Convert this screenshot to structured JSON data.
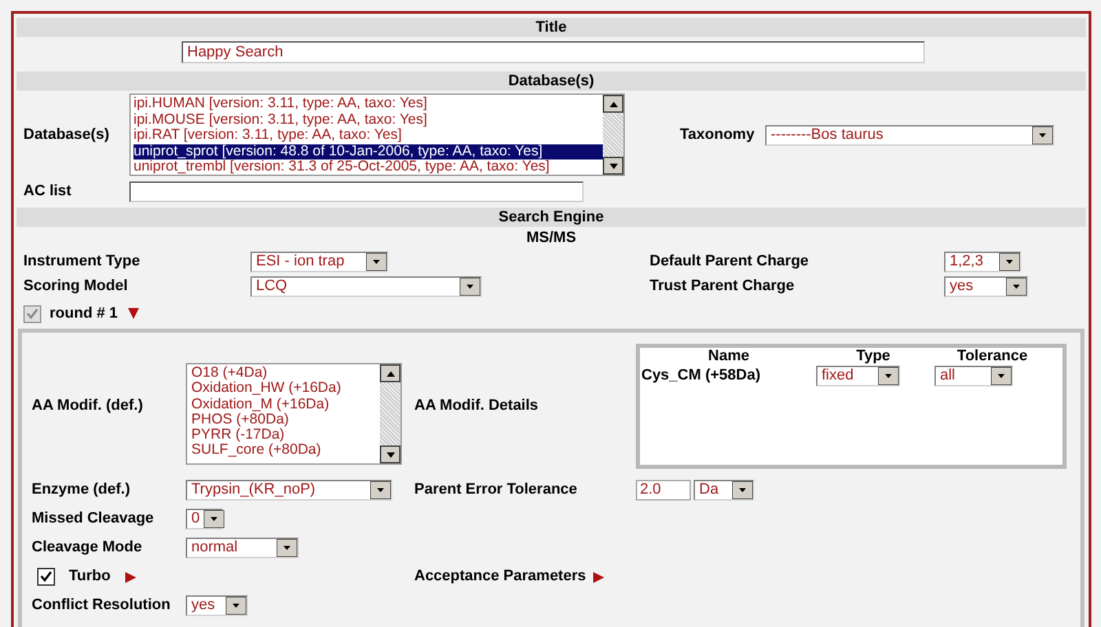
{
  "title_section": {
    "header": "Title",
    "value": "Happy Search"
  },
  "database_section": {
    "header": "Database(s)",
    "label": "Database(s)",
    "databases": [
      {
        "name": "ipi.HUMAN [version: 3.11, type: AA, taxo: Yes]",
        "selected": false
      },
      {
        "name": "ipi.MOUSE [version: 3.11, type: AA, taxo: Yes]",
        "selected": false
      },
      {
        "name": "ipi.RAT [version: 3.11, type: AA, taxo: Yes]",
        "selected": false
      },
      {
        "name": "uniprot_sprot [version: 48.8 of 10-Jan-2006, type: AA, taxo: Yes]",
        "selected": true
      },
      {
        "name": "uniprot_trembl [version: 31.3 of 25-Oct-2005, type: AA, taxo: Yes]",
        "selected": false
      }
    ],
    "taxonomy_label": "Taxonomy",
    "taxonomy": "--------Bos taurus",
    "ac_list_label": "AC list"
  },
  "search_engine": {
    "header": "Search Engine",
    "subheader": "MS/MS",
    "instrument_type": {
      "label": "Instrument Type",
      "value": "ESI - ion trap"
    },
    "scoring_model": {
      "label": "Scoring Model",
      "value": "LCQ"
    },
    "default_parent_charge": {
      "label": "Default Parent Charge",
      "value": "1,2,3"
    },
    "trust_parent_charge": {
      "label": "Trust Parent Charge",
      "value": "yes"
    }
  },
  "round": {
    "label": "round # 1",
    "checked": true,
    "disabled": true,
    "expanded": true,
    "aa_modif_label": "AA Modif. (def.)",
    "modifications": [
      {
        "name": "O18 (+4Da)",
        "selected": false
      },
      {
        "name": "Oxidation_HW (+16Da)",
        "selected": false
      },
      {
        "name": "Oxidation_M (+16Da)",
        "selected": false
      },
      {
        "name": "PHOS (+80Da)",
        "selected": false
      },
      {
        "name": "PYRR (-17Da)",
        "selected": false
      },
      {
        "name": "SULF_core (+80Da)",
        "selected": false
      }
    ],
    "details_label": "AA Modif. Details",
    "details_columns": [
      "Name",
      "Type",
      "Tolerance"
    ],
    "details_rows": [
      {
        "name": "Cys_CM (+58Da)",
        "type": "fixed",
        "tolerance": "all"
      }
    ],
    "enzyme": {
      "label": "Enzyme (def.)",
      "value": "Trypsin_(KR_noP)"
    },
    "parent_error": {
      "label": "Parent Error Tolerance",
      "value": "2.0",
      "unit": "Da"
    },
    "missed_cleavage": {
      "label": "Missed Cleavage",
      "value": "0"
    },
    "cleavage_mode": {
      "label": "Cleavage Mode",
      "value": "normal"
    },
    "turbo": {
      "label": "Turbo",
      "checked": true,
      "expanded": false
    },
    "acceptance": {
      "label": "Acceptance Parameters",
      "expanded": false
    },
    "conflict_resolution": {
      "label": "Conflict Resolution",
      "value": "yes"
    }
  }
}
